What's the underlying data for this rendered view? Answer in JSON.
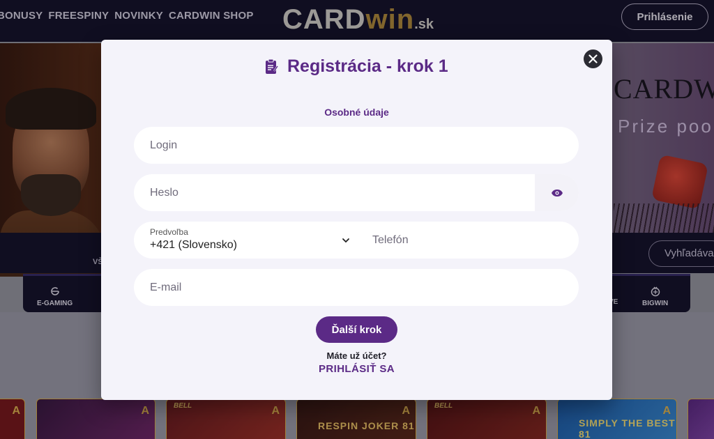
{
  "header": {
    "nav": [
      "BONUSY",
      "FREESPINY",
      "NOVINKY",
      "CARDWIN SHOP"
    ],
    "logo": {
      "part1": "CARD",
      "part2": "win",
      "part3": ".sk"
    },
    "login_button": "Prihlásenie"
  },
  "banner": {
    "promo_brand": "CARDW",
    "promo_text": "Prize poo"
  },
  "strip": {
    "partial_label": "VŠ",
    "search_placeholder": "Vyhľadáva"
  },
  "categories": {
    "egaming": "E-GAMING",
    "partial": "VE",
    "bigwin": "BIGWIN"
  },
  "tiles": {
    "badge": "A",
    "bell_label": "BELL",
    "respin_title": "RESPIN JOKER 81",
    "simply_title": "SIMPLY THE BEST 81"
  },
  "modal": {
    "title": "Registrácia - krok 1",
    "section": "Osobné údaje",
    "login_placeholder": "Login",
    "password_placeholder": "Heslo",
    "prefix_label": "Predvoľba",
    "prefix_value": "+421 (Slovensko)",
    "phone_placeholder": "Telefón",
    "email_placeholder": "E-mail",
    "next_button": "Ďalší krok",
    "have_account": "Máte už účet?",
    "login_link": "PRIHLÁSIŤ SA"
  },
  "colors": {
    "accent": "#5b2a86",
    "topbar": "#17142f",
    "modal_bg": "#f4f3fa",
    "gold": "#b58e3f"
  },
  "icons": {
    "close": "close-icon",
    "eye": "eye-icon",
    "chevron": "chevron-down-icon",
    "register": "register-form-icon"
  }
}
